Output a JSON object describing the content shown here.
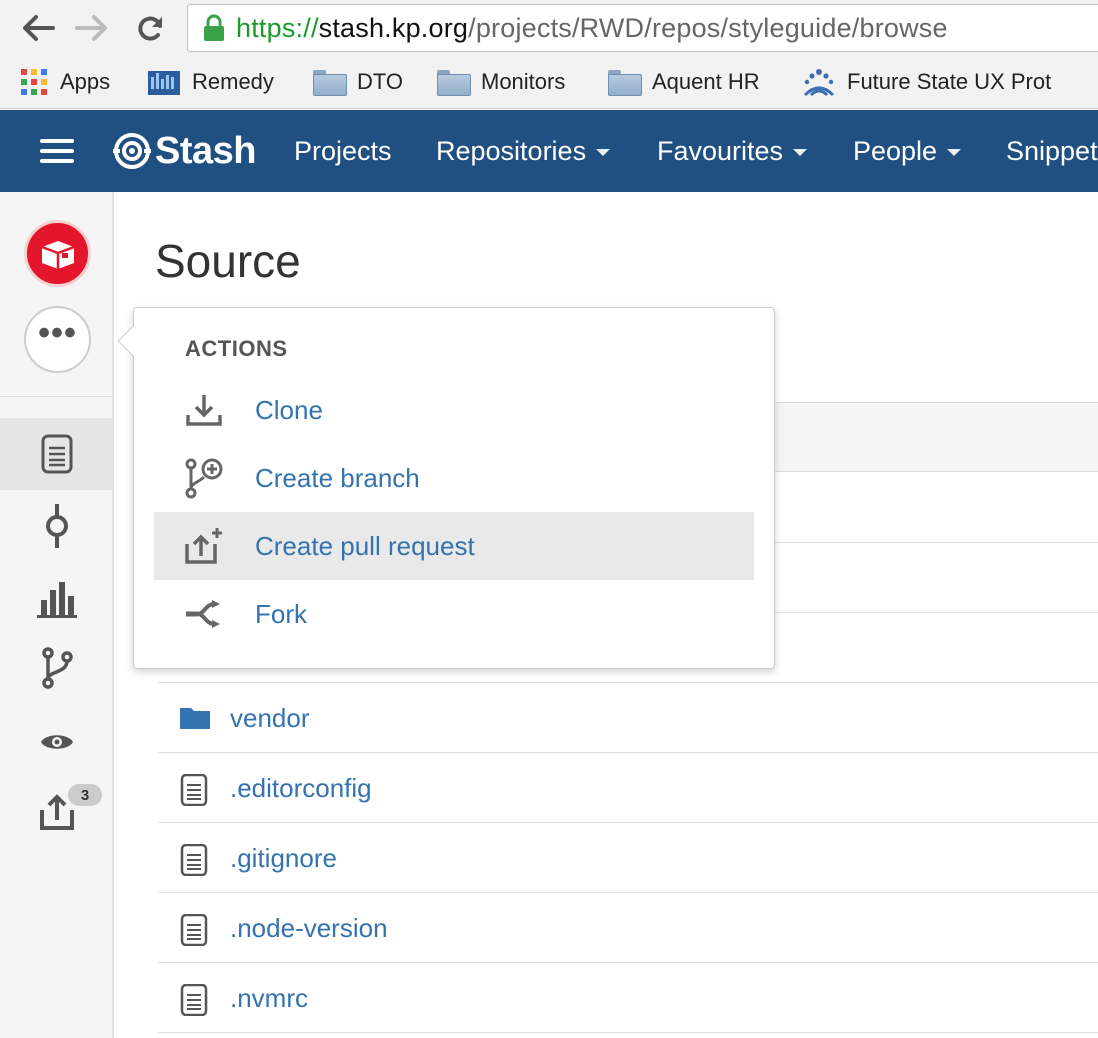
{
  "browser": {
    "url_scheme": "https://",
    "url_host": "stash.kp.org",
    "url_path": "/projects/RWD/repos/styleguide/browse",
    "bookmarks": [
      {
        "label": "Apps",
        "icon": "apps-grid-icon"
      },
      {
        "label": "Remedy",
        "icon": "remedy-icon"
      },
      {
        "label": "DTO",
        "icon": "folder-icon"
      },
      {
        "label": "Monitors",
        "icon": "folder-icon"
      },
      {
        "label": "Aquent HR",
        "icon": "folder-icon"
      },
      {
        "label": "Future State UX Prot",
        "icon": "kp-logo-icon"
      }
    ]
  },
  "header": {
    "logo": "Stash",
    "nav": [
      {
        "label": "Projects",
        "dropdown": false
      },
      {
        "label": "Repositories",
        "dropdown": true
      },
      {
        "label": "Favourites",
        "dropdown": true
      },
      {
        "label": "People",
        "dropdown": true
      },
      {
        "label": "Snippets",
        "dropdown": false
      }
    ],
    "color": "#205081"
  },
  "sidebar": {
    "more_label": "•••",
    "pull_request_count": "3",
    "items": [
      "source-icon",
      "commits-icon",
      "stats-icon",
      "branches-icon",
      "watch-icon",
      "pull-requests-icon"
    ]
  },
  "main": {
    "title": "Source",
    "files": [
      {
        "name": "vendor",
        "type": "folder"
      },
      {
        "name": ".editorconfig",
        "type": "file"
      },
      {
        "name": ".gitignore",
        "type": "file"
      },
      {
        "name": ".node-version",
        "type": "file"
      },
      {
        "name": ".nvmrc",
        "type": "file"
      }
    ]
  },
  "actions_menu": {
    "heading": "ACTIONS",
    "items": [
      {
        "label": "Clone",
        "icon": "download-icon"
      },
      {
        "label": "Create branch",
        "icon": "create-branch-icon"
      },
      {
        "label": "Create pull request",
        "icon": "create-pull-request-icon",
        "highlighted": true
      },
      {
        "label": "Fork",
        "icon": "fork-icon"
      }
    ]
  },
  "colors": {
    "link": "#3572b0",
    "avatar": "#e4162b"
  }
}
